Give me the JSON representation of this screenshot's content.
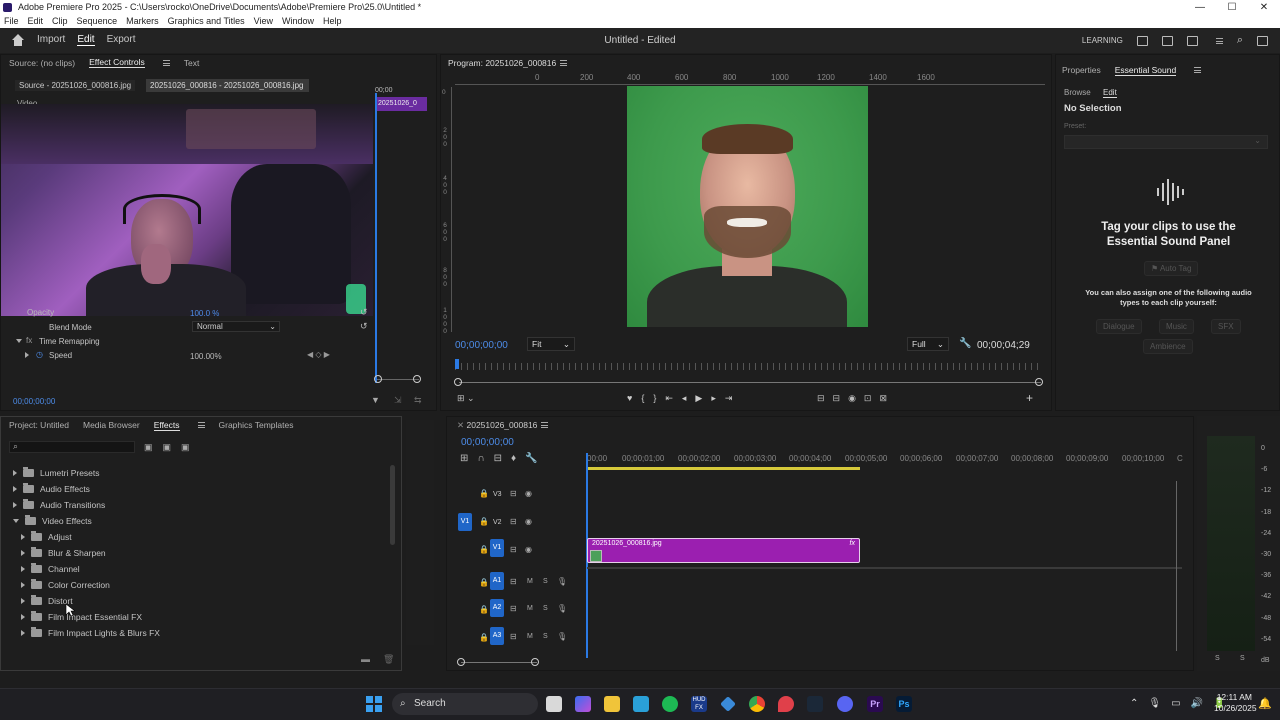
{
  "window": {
    "title": "Adobe Premiere Pro 2025 - C:\\Users\\rocko\\OneDrive\\Documents\\Adobe\\Premiere Pro\\25.0\\Untitled *",
    "controls": [
      "—",
      "☐",
      "✕"
    ]
  },
  "menu": [
    "File",
    "Edit",
    "Clip",
    "Sequence",
    "Markers",
    "Graphics and Titles",
    "View",
    "Window",
    "Help"
  ],
  "header": {
    "tabs": [
      "Import",
      "Edit",
      "Export"
    ],
    "active_tab": "Edit",
    "doc_title": "Untitled - Edited",
    "learning": "LEARNING"
  },
  "source_panel": {
    "tabs": [
      "Source: (no clips)",
      "Effect Controls",
      "Text"
    ],
    "active_tab": "Effect Controls",
    "clip_tabs": [
      "Source - 20251026_000816.jpg",
      "20251026_000816 - 20251026_000816.jpg"
    ],
    "mini_time": "00;00",
    "clip_label": "20251026_0",
    "video_label": "Video",
    "opacity_label": "Opacity",
    "opacity_value": "100.0 %",
    "blend_mode_label": "Blend Mode",
    "blend_mode_value": "Normal",
    "time_remap_label": "Time Remapping",
    "speed_label": "Speed",
    "speed_value": "100.00%",
    "timecode": "00;00;00;00"
  },
  "program": {
    "title": "Program: 20251026_000816",
    "ruler": [
      "0",
      "200",
      "400",
      "600",
      "800",
      "1000",
      "1200",
      "1400",
      "1600"
    ],
    "side_ruler": [
      "0",
      "2 0 0",
      "4 0 0",
      "6 0 0",
      "8 0 0",
      "1 0 0 0"
    ],
    "timecode": "00;00;00;00",
    "fit": "Fit",
    "quality": "Full",
    "duration": "00;00;04;29"
  },
  "essential_sound": {
    "tabs": [
      "Properties",
      "Essential Sound"
    ],
    "active_tab": "Essential Sound",
    "subtabs": [
      "Browse",
      "Edit"
    ],
    "active_subtab": "Edit",
    "selection": "No Selection",
    "preset_label": "Preset:",
    "headline": "Tag your clips to use the Essential Sound Panel",
    "auto_tag": "Auto Tag",
    "assign_text": "You can also assign one of the following audio types to each clip yourself:",
    "types": [
      "Dialogue",
      "Music",
      "SFX",
      "Ambience"
    ]
  },
  "effects_panel": {
    "tabs": [
      "Project: Untitled",
      "Media Browser",
      "Effects",
      "Graphics Templates"
    ],
    "active_tab": "Effects",
    "top_items": [
      "Lumetri Presets",
      "Audio Effects",
      "Audio Transitions",
      "Video Effects"
    ],
    "sub_items": [
      "Adjust",
      "Blur & Sharpen",
      "Channel",
      "Color Correction",
      "Distort",
      "Film Impact Essential FX",
      "Film Impact Lights & Blurs FX"
    ]
  },
  "timeline": {
    "sequence": "20251026_000816",
    "timecode": "00;00;00;00",
    "ruler": [
      "00;00",
      "00;00;01;00",
      "00;00;02;00",
      "00;00;03;00",
      "00;00;04;00",
      "00;00;05;00",
      "00;00;06;00",
      "00;00;07;00",
      "00;00;08;00",
      "00;00;09;00",
      "00;00;10;00",
      "C"
    ],
    "video_tracks": [
      "V3",
      "V2",
      "V1"
    ],
    "audio_tracks": [
      "A1",
      "A2",
      "A3"
    ],
    "src_video": "V1",
    "clip_name": "20251026_000816.jpg",
    "clip_fx": "fx",
    "track_m": "M",
    "track_s": "S"
  },
  "meter": {
    "scale": [
      "0",
      "-6",
      "-12",
      "-18",
      "-24",
      "-30",
      "-36",
      "-42",
      "-48",
      "-54",
      "dB"
    ],
    "channels": [
      "S",
      "S"
    ]
  },
  "taskbar": {
    "search": "Search",
    "time": "12:11 AM",
    "date": "10/26/2025",
    "hud": "HUD\nFX"
  },
  "colors": {
    "accent": "#2b7ae4",
    "clip": "#9b1fb0",
    "green": "#3d9a4c"
  }
}
